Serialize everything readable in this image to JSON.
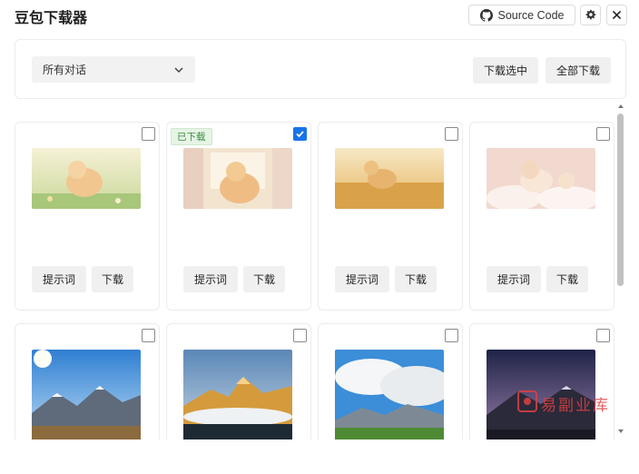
{
  "app": {
    "title": "豆包下载器"
  },
  "header": {
    "source_label": "Source Code",
    "icons": [
      "github-icon",
      "gear-icon",
      "close-icon"
    ]
  },
  "toolbar": {
    "filter_value": "所有对话",
    "download_selected_label": "下载选中",
    "download_all_label": "全部下载"
  },
  "cards": [
    {
      "checked": false,
      "badge": "",
      "image": "pomeranian-in-flower-field",
      "prompt_label": "提示词",
      "download_label": "下载"
    },
    {
      "checked": true,
      "badge": "已下载",
      "image": "pomeranian-by-window",
      "prompt_label": "提示词",
      "download_label": "下载"
    },
    {
      "checked": false,
      "badge": "",
      "image": "puppy-running-wheat-field",
      "prompt_label": "提示词",
      "download_label": "下载"
    },
    {
      "checked": false,
      "badge": "",
      "image": "puppy-on-clouds",
      "prompt_label": "提示词",
      "download_label": "下载"
    },
    {
      "checked": false,
      "badge": "",
      "image": "mountain-blue-sky",
      "prompt_label": "",
      "download_label": ""
    },
    {
      "checked": false,
      "badge": "",
      "image": "golden-peaks-sea-of-clouds",
      "prompt_label": "",
      "download_label": ""
    },
    {
      "checked": false,
      "badge": "",
      "image": "clouds-over-green-valley",
      "prompt_label": "",
      "download_label": ""
    },
    {
      "checked": false,
      "badge": "",
      "image": "mountains-at-dusk",
      "prompt_label": "",
      "download_label": ""
    }
  ],
  "watermark": {
    "text": "易副业库"
  },
  "colors": {
    "accent": "#1a73e8",
    "badge_bg": "#e6f4e6",
    "badge_text": "#3a8a3a"
  }
}
